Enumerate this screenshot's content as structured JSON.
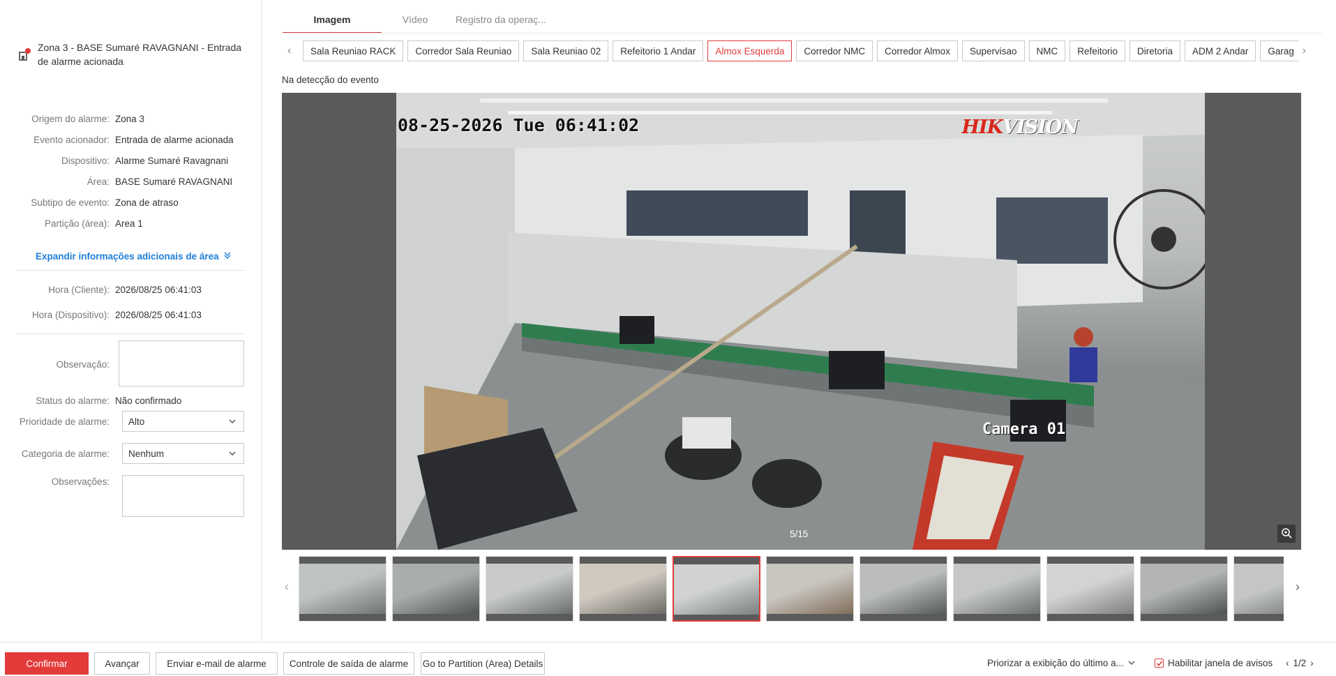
{
  "alarm": {
    "title": "Zona 3 - BASE Sumaré RAVAGNANI - Entrada de alarme acionada"
  },
  "details": [
    {
      "label": "Origem do alarme:",
      "value": "Zona 3"
    },
    {
      "label": "Evento acionador:",
      "value": "Entrada de alarme acionada"
    },
    {
      "label": "Dispositivo:",
      "value": "Alarme Sumaré Ravagnani"
    },
    {
      "label": "Área:",
      "value": "BASE Sumaré RAVAGNANI"
    },
    {
      "label": "Subtipo de evento:",
      "value": "Zona de atraso"
    },
    {
      "label": "Partição (área):",
      "value": "Area 1"
    }
  ],
  "expand_label": "Expandir informações adicionais de área",
  "times": [
    {
      "label": "Hora (Cliente):",
      "value": "2026/08/25 06:41:03"
    },
    {
      "label": "Hora (Dispositivo):",
      "value": "2026/08/25 06:41:03"
    }
  ],
  "form": {
    "observacao_label": "Observação:",
    "status_label": "Status do alarme:",
    "status_value": "Não confirmado",
    "priority_label": "Prioridade de alarme:",
    "priority_value": "Alto",
    "category_label": "Categoria de alarme:",
    "category_value": "Nenhum",
    "observacoes_label": "Observações:"
  },
  "tabs": [
    "Imagem",
    "Vídeo",
    "Registro da operaç..."
  ],
  "cameras": [
    "Sala Reuniao RACK",
    "Corredor Sala Reuniao",
    "Sala Reuniao 02",
    "Refeitorio 1 Andar",
    "Almox Esquerda",
    "Corredor NMC",
    "Corredor Almox",
    "Supervisao",
    "NMC",
    "Refeitorio",
    "Diretoria",
    "ADM 2 Andar",
    "Garag"
  ],
  "active_camera": "Almox Esquerda",
  "caption": "Na detecção do evento",
  "viewer": {
    "osd_time": "08-25-2026 Tue 06:41:02",
    "brand_hik": "HIK",
    "brand_vision": "VISION",
    "osd_camera": "Camera 01",
    "counter": "5/15"
  },
  "thumbnail_count_visible": 11,
  "active_thumbnail": 5,
  "footer": {
    "confirm": "Confirmar",
    "advance": "Avançar",
    "email": "Enviar e-mail de alarme",
    "output": "Controle de saída de alarme",
    "partition": "Go to Partition (Area) Details",
    "prioritize": "Priorizar a exibição do último a...",
    "enable_popup": "Habilitar janela de avisos",
    "page": "1/2"
  },
  "colors": {
    "accent": "#e03b3b",
    "link": "#1e7ed6"
  }
}
